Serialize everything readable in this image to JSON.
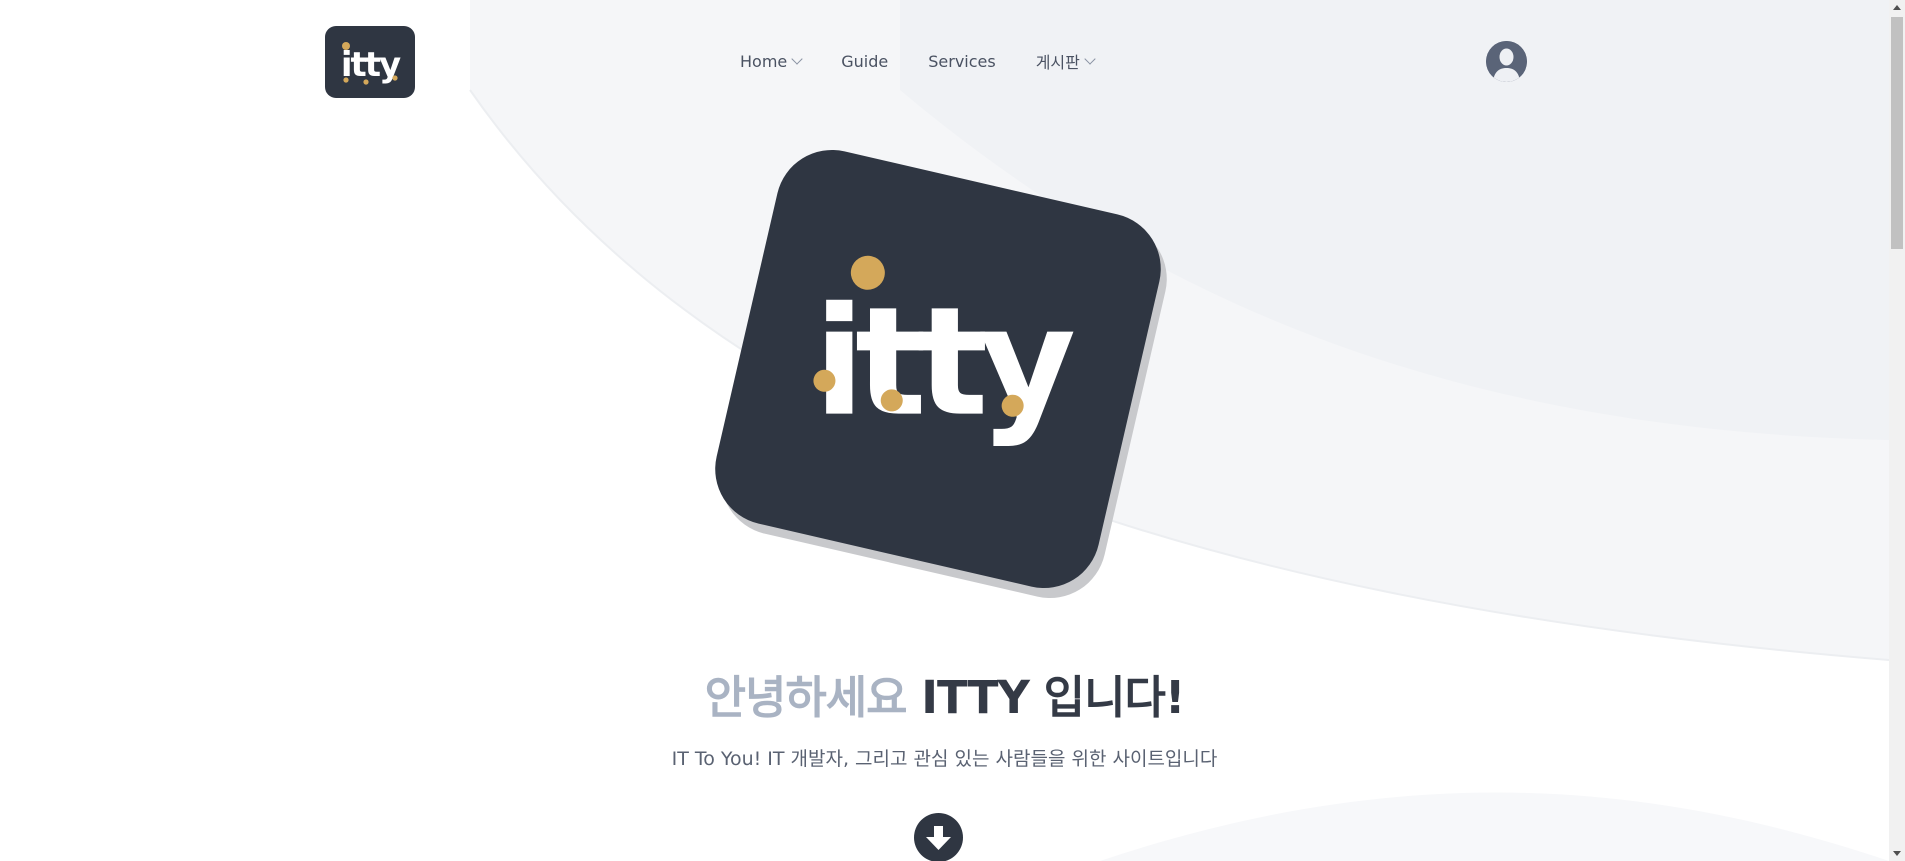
{
  "header": {
    "logo_alt": "itty",
    "nav": [
      {
        "label": "Home",
        "has_dropdown": true
      },
      {
        "label": "Guide",
        "has_dropdown": false
      },
      {
        "label": "Services",
        "has_dropdown": false
      },
      {
        "label": "게시판",
        "has_dropdown": true
      }
    ],
    "avatar_icon": "user-avatar-icon"
  },
  "hero": {
    "logo_text": "itty",
    "headline_light": "안녕하세요",
    "headline_dark": "ITTY 입니다!",
    "subtitle": "IT To You! IT 개발자, 그리고 관심 있는 사람들을 위한 사이트입니다",
    "scroll_button_icon": "arrow-down-icon"
  },
  "colors": {
    "brand_dark": "#2f3642",
    "brand_gold": "#d4a85a",
    "headline_light": "#a9b3c3",
    "headline_dark": "#343a46"
  }
}
